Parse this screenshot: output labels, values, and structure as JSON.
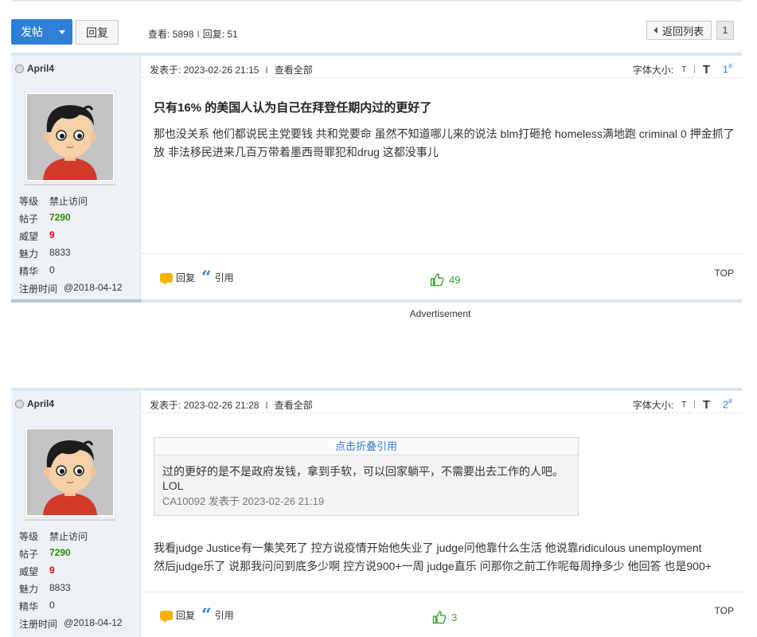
{
  "toolbar": {
    "post_label": "发帖",
    "reply_label": "回复",
    "views_label": "查看: 5898",
    "replies_label": "回复: 51",
    "stats_sep": "I",
    "back_label": "返回列表",
    "page": "1"
  },
  "posts": [
    {
      "author": "April4",
      "level_k": "等级",
      "level_v": "禁止访问",
      "posts_k": "帖子",
      "posts_v": "7290",
      "rep_k": "威望",
      "rep_v": "9",
      "charm_k": "魅力",
      "charm_v": "8833",
      "elite_k": "精华",
      "elite_v": "0",
      "reg_k": "注册时间",
      "reg_v": "@2018-04-12",
      "posted": "发表于: 2023-02-26 21:15",
      "sep": "I",
      "view_all": "查看全部",
      "fontsize_label": "字体大小:",
      "font_small": "T",
      "font_sep": "|",
      "font_large": "T",
      "floor": "1",
      "floor_mark": "#",
      "title": "只有16% 的美国人认为自己在拜登任期内过的更好了",
      "body": "那也没关系 他们都说民主党要钱 共和党要命 虽然不知道哪儿来的说法 blm打砸抢 homeless满地跑 criminal 0 押金抓了放 非法移民进来几百万带着墨西哥罪犯和drug 这都没事儿",
      "reply_label": "回复",
      "quote_label": "引用",
      "likes": "49",
      "top_label": "TOP"
    },
    {
      "author": "April4",
      "level_k": "等级",
      "level_v": "禁止访问",
      "posts_k": "帖子",
      "posts_v": "7290",
      "rep_k": "威望",
      "rep_v": "9",
      "charm_k": "魅力",
      "charm_v": "8833",
      "elite_k": "精华",
      "elite_v": "0",
      "reg_k": "注册时间",
      "reg_v": "@2018-04-12",
      "posted": "发表于: 2023-02-26 21:28",
      "sep": "I",
      "view_all": "查看全部",
      "fontsize_label": "字体大小:",
      "font_small": "T",
      "font_sep": "|",
      "font_large": "T",
      "floor": "2",
      "floor_mark": "#",
      "quote_toggle": "点击折叠引用",
      "quote_text": "过的更好的是不是政府发钱，拿到手软，可以回家躺平，不需要出去工作的人吧。LOL",
      "quote_meta": "CA10092 发表于 2023-02-26 21:19",
      "body": "我看judge Justice有一集笑死了 控方说疫情开始他失业了 judge问他靠什么生活 他说靠ridiculous unemployment 然后judge乐了 说那我问问到底多少啊 控方说900+一周 judge直乐 问那你之前工作呢每周挣多少 他回答 也是900+",
      "reply_label": "回复",
      "quote_label": "引用",
      "likes": "3",
      "top_label": "TOP"
    }
  ],
  "ad_label": "Advertisement",
  "colors": {
    "accent": "#2f7fd6",
    "like": "#3aa53a",
    "green": "#2e8b00",
    "red": "#ee0000"
  }
}
